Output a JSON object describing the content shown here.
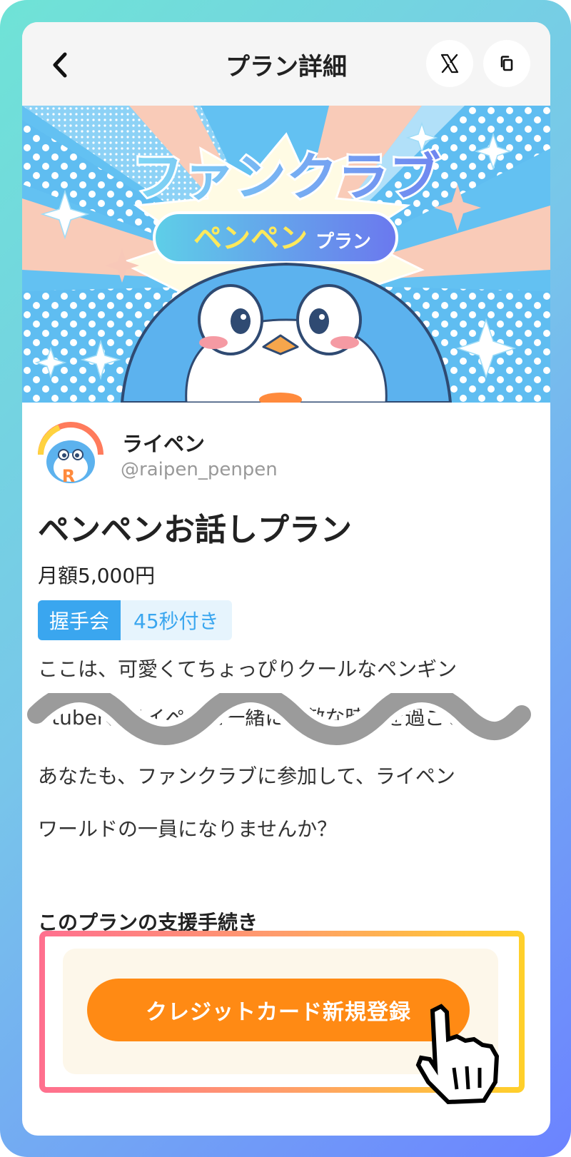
{
  "header": {
    "title": "プラン詳細",
    "back_icon": "chevron-left-icon",
    "share_x_icon": "x-logo-icon",
    "copy_icon": "copy-icon"
  },
  "banner": {
    "title": "ファンクラブ",
    "subtitle_main": "ペンペン",
    "subtitle_suffix": "プラン"
  },
  "creator": {
    "avatar_letter": "R",
    "name": "ライペン",
    "handle": "@raipen_penpen"
  },
  "plan": {
    "title": "ペンペンお話しプラン",
    "price": "月額5,000円",
    "tag_label": "握手会",
    "tag_detail": "45秒付き"
  },
  "description": {
    "line1": "ここは、可愛くてちょっぴりクールなペンギン",
    "line2": "Vtuber、ライペンと一緒に素敵な時間を過ごせ",
    "line3": "あなたも、ファンクラブに参加して、ライペン",
    "line4": "ワールドの一員になりませんか？"
  },
  "support": {
    "section_title": "このプランの支援手続き",
    "cta_label": "クレジットカード新規登録"
  },
  "colors": {
    "accent_blue": "#3aa6ef",
    "cta_orange": "#ff8a14",
    "frame_start": "#6fe3d6",
    "frame_end": "#6c83ff"
  }
}
